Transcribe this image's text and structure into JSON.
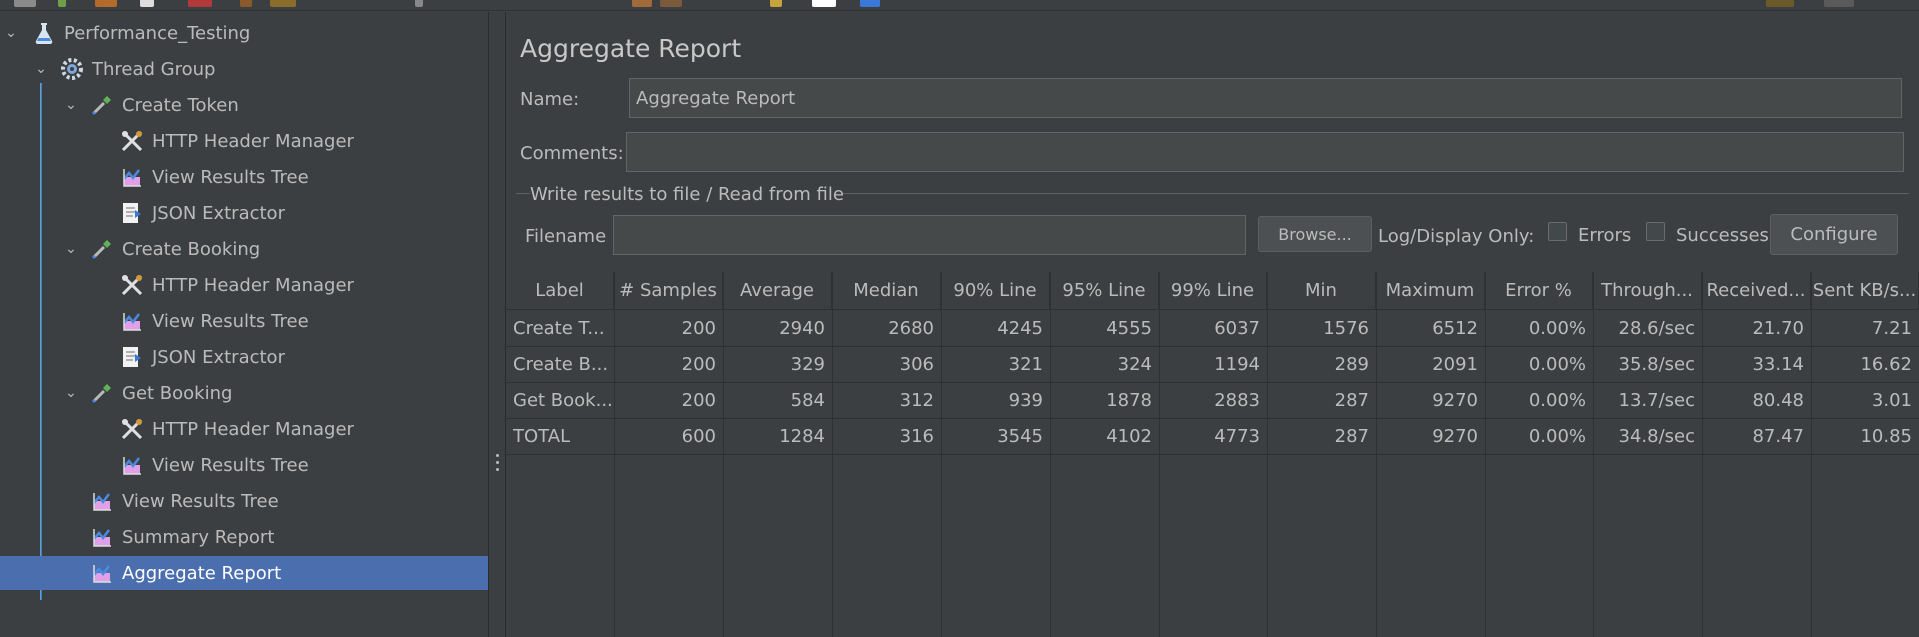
{
  "tree": {
    "nodes": [
      {
        "label": "Performance_Testing",
        "icon": "flask-icon"
      },
      {
        "label": "Thread Group",
        "icon": "gear-icon"
      },
      {
        "label": "Create Token",
        "icon": "sampler-pipette-icon"
      },
      {
        "label": "HTTP Header Manager",
        "icon": "wrench-tools-icon"
      },
      {
        "label": "View Results Tree",
        "icon": "graph-listener-icon"
      },
      {
        "label": "JSON Extractor",
        "icon": "document-extractor-icon"
      },
      {
        "label": "Create Booking",
        "icon": "sampler-pipette-icon"
      },
      {
        "label": "HTTP Header Manager",
        "icon": "wrench-tools-icon"
      },
      {
        "label": "View Results Tree",
        "icon": "graph-listener-icon"
      },
      {
        "label": "JSON Extractor",
        "icon": "document-extractor-icon"
      },
      {
        "label": "Get Booking",
        "icon": "sampler-pipette-icon"
      },
      {
        "label": "HTTP Header Manager",
        "icon": "wrench-tools-icon"
      },
      {
        "label": "View Results Tree",
        "icon": "graph-listener-icon"
      },
      {
        "label": "View Results Tree",
        "icon": "graph-listener-icon"
      },
      {
        "label": "Summary Report",
        "icon": "graph-listener-icon"
      },
      {
        "label": "Aggregate Report",
        "icon": "graph-listener-icon"
      }
    ],
    "selected_label": "Aggregate Report"
  },
  "panel": {
    "title": "Aggregate Report",
    "name_label": "Name:",
    "name_value": "Aggregate Report",
    "comments_label": "Comments:",
    "comments_value": "",
    "file_group_title": "Write results to file / Read from file",
    "filename_label": "Filename",
    "filename_value": "",
    "browse_label": "Browse...",
    "log_display_label": "Log/Display Only:",
    "errors_label": "Errors",
    "successes_label": "Successes",
    "configure_label": "Configure"
  },
  "table": {
    "headers": [
      "Label",
      "# Samples",
      "Average",
      "Median",
      "90% Line",
      "95% Line",
      "99% Line",
      "Min",
      "Maximum",
      "Error %",
      "Through...",
      "Received...",
      "Sent KB/s..."
    ],
    "rows": [
      [
        "Create T...",
        "200",
        "2940",
        "2680",
        "4245",
        "4555",
        "6037",
        "1576",
        "6512",
        "0.00%",
        "28.6/sec",
        "21.70",
        "7.21"
      ],
      [
        "Create B...",
        "200",
        "329",
        "306",
        "321",
        "324",
        "1194",
        "289",
        "2091",
        "0.00%",
        "35.8/sec",
        "33.14",
        "16.62"
      ],
      [
        "Get Book...",
        "200",
        "584",
        "312",
        "939",
        "1878",
        "2883",
        "287",
        "9270",
        "0.00%",
        "13.7/sec",
        "80.48",
        "3.01"
      ],
      [
        "TOTAL",
        "600",
        "1284",
        "316",
        "3545",
        "4102",
        "4773",
        "287",
        "9270",
        "0.00%",
        "34.8/sec",
        "87.47",
        "10.85"
      ]
    ]
  },
  "colors": {
    "background": "#3c3f41",
    "selection": "#4b6eaf",
    "text": "#bbbbbb",
    "tree_line": "#5a9fd6"
  }
}
